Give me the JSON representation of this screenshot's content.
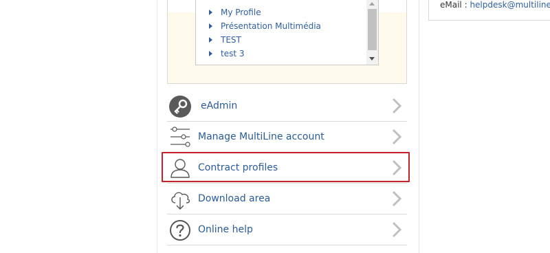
{
  "profiles": {
    "items": [
      {
        "label": "My Profile"
      },
      {
        "label": "Présentation Multimédia"
      },
      {
        "label": "TEST"
      },
      {
        "label": "test 3"
      }
    ]
  },
  "menu": {
    "items": [
      {
        "label": "eAdmin",
        "icon": "key-icon"
      },
      {
        "label": "Manage MultiLine account",
        "icon": "sliders-icon"
      },
      {
        "label": "Contract profiles",
        "icon": "user-icon",
        "highlighted": true
      },
      {
        "label": "Download area",
        "icon": "cloud-download-icon"
      },
      {
        "label": "Online help",
        "icon": "question-icon"
      }
    ]
  },
  "contact": {
    "email_label": "eMail : ",
    "email_value": "helpdesk@multiline"
  },
  "colors": {
    "link": "#2a5b96",
    "highlight_border": "#c8202a",
    "panel_bg": "#fff9ec"
  }
}
